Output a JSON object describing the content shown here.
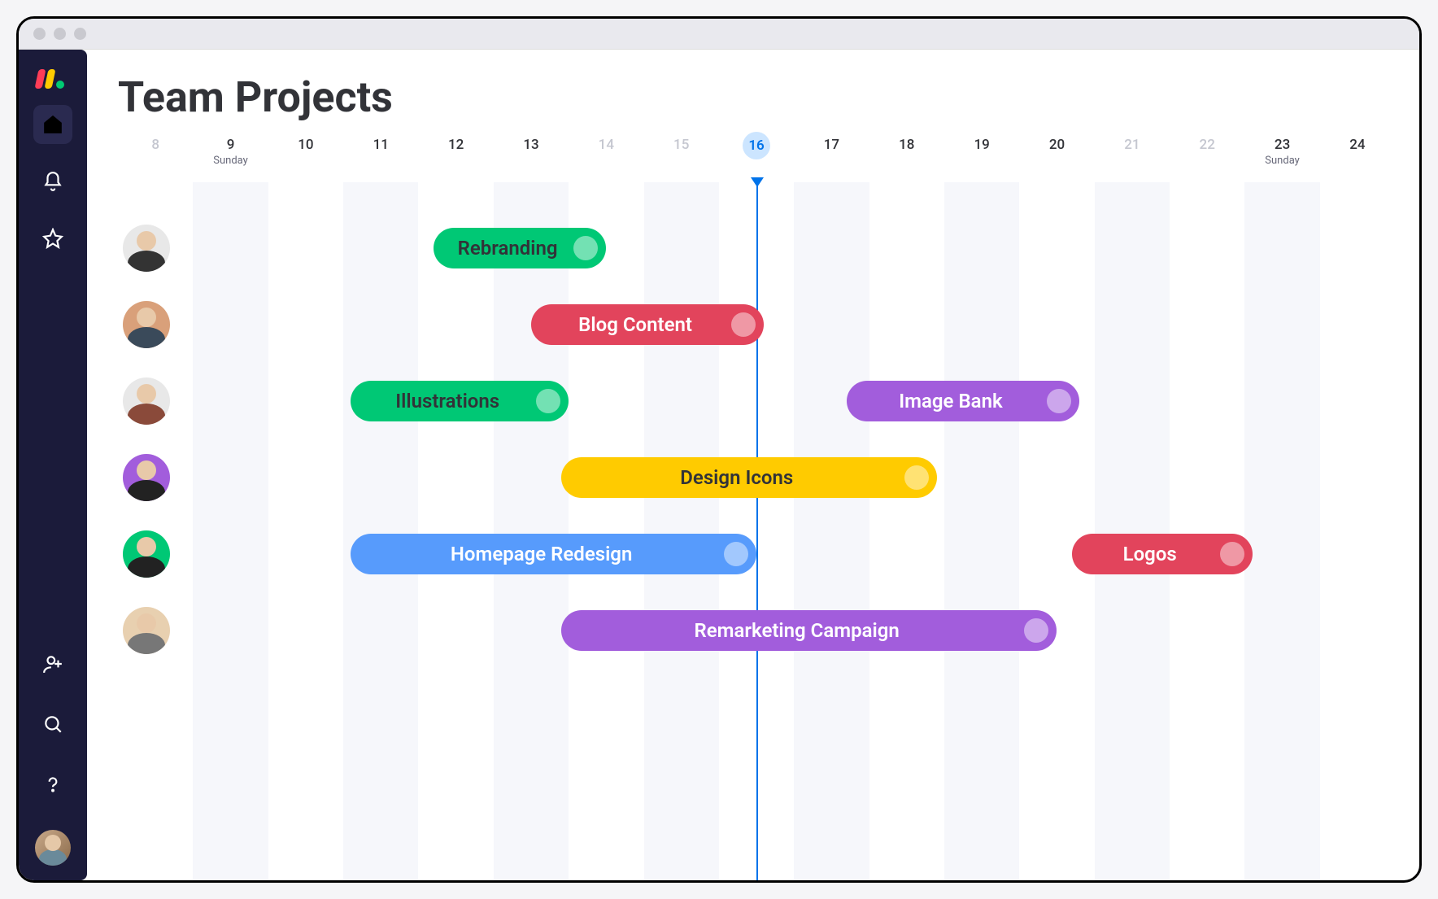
{
  "page": {
    "title": "Team Projects"
  },
  "calendar": {
    "days": [
      {
        "num": "8",
        "day": "",
        "muted": true,
        "shaded": false,
        "today": false
      },
      {
        "num": "9",
        "day": "Sunday",
        "muted": false,
        "shaded": true,
        "today": false
      },
      {
        "num": "10",
        "day": "",
        "muted": false,
        "shaded": false,
        "today": false
      },
      {
        "num": "11",
        "day": "",
        "muted": false,
        "shaded": true,
        "today": false
      },
      {
        "num": "12",
        "day": "",
        "muted": false,
        "shaded": false,
        "today": false
      },
      {
        "num": "13",
        "day": "",
        "muted": false,
        "shaded": true,
        "today": false
      },
      {
        "num": "14",
        "day": "",
        "muted": true,
        "shaded": false,
        "today": false
      },
      {
        "num": "15",
        "day": "",
        "muted": true,
        "shaded": true,
        "today": false
      },
      {
        "num": "16",
        "day": "",
        "muted": false,
        "shaded": false,
        "today": true
      },
      {
        "num": "17",
        "day": "",
        "muted": false,
        "shaded": true,
        "today": false
      },
      {
        "num": "18",
        "day": "",
        "muted": false,
        "shaded": false,
        "today": false
      },
      {
        "num": "19",
        "day": "",
        "muted": false,
        "shaded": true,
        "today": false
      },
      {
        "num": "20",
        "day": "",
        "muted": false,
        "shaded": false,
        "today": false
      },
      {
        "num": "21",
        "day": "",
        "muted": true,
        "shaded": true,
        "today": false
      },
      {
        "num": "22",
        "day": "",
        "muted": true,
        "shaded": false,
        "today": false
      },
      {
        "num": "23",
        "day": "Sunday",
        "muted": false,
        "shaded": true,
        "today": false
      },
      {
        "num": "24",
        "day": "",
        "muted": false,
        "shaded": false,
        "today": false
      }
    ]
  },
  "colors": {
    "green": "#00c875",
    "red": "#e2445c",
    "yellow": "#fdab3d",
    "gold": "#ffcb00",
    "purple": "#a25ddc",
    "blue": "#579bfc"
  },
  "rows": [
    {
      "avatar": {
        "bg": "#e8e8e8",
        "body": "#333"
      },
      "tasks": [
        {
          "label": "Rebranding",
          "start": 11.7,
          "end": 14.0,
          "color": "green",
          "darkText": true
        }
      ]
    },
    {
      "avatar": {
        "bg": "#d9a07a",
        "body": "#3a4a5a"
      },
      "tasks": [
        {
          "label": "Blog Content",
          "start": 13.0,
          "end": 16.1,
          "color": "red",
          "darkText": false
        }
      ]
    },
    {
      "avatar": {
        "bg": "#e8e8e8",
        "body": "#8a4a3a"
      },
      "tasks": [
        {
          "label": "Illustrations",
          "start": 10.6,
          "end": 13.5,
          "color": "green",
          "darkText": true
        },
        {
          "label": "Image Bank",
          "start": 17.2,
          "end": 20.3,
          "color": "purple",
          "darkText": false
        }
      ]
    },
    {
      "avatar": {
        "bg": "#a25ddc",
        "body": "#222"
      },
      "tasks": [
        {
          "label": "Design Icons",
          "start": 13.4,
          "end": 18.4,
          "color": "gold",
          "darkText": true
        }
      ]
    },
    {
      "avatar": {
        "bg": "#00c875",
        "body": "#222"
      },
      "tasks": [
        {
          "label": "Homepage Redesign",
          "start": 10.6,
          "end": 16.0,
          "color": "blue",
          "darkText": false
        },
        {
          "label": "Logos",
          "start": 20.2,
          "end": 22.6,
          "color": "red",
          "darkText": false
        }
      ]
    },
    {
      "avatar": {
        "bg": "#e8d0b0",
        "body": "#777"
      },
      "tasks": [
        {
          "label": "Remarketing Campaign",
          "start": 13.4,
          "end": 20.0,
          "color": "purple",
          "darkText": false
        }
      ]
    }
  ],
  "sidebar": {
    "icons": [
      "home",
      "bell",
      "star"
    ],
    "bottom_icons": [
      "invite",
      "search",
      "help"
    ]
  }
}
